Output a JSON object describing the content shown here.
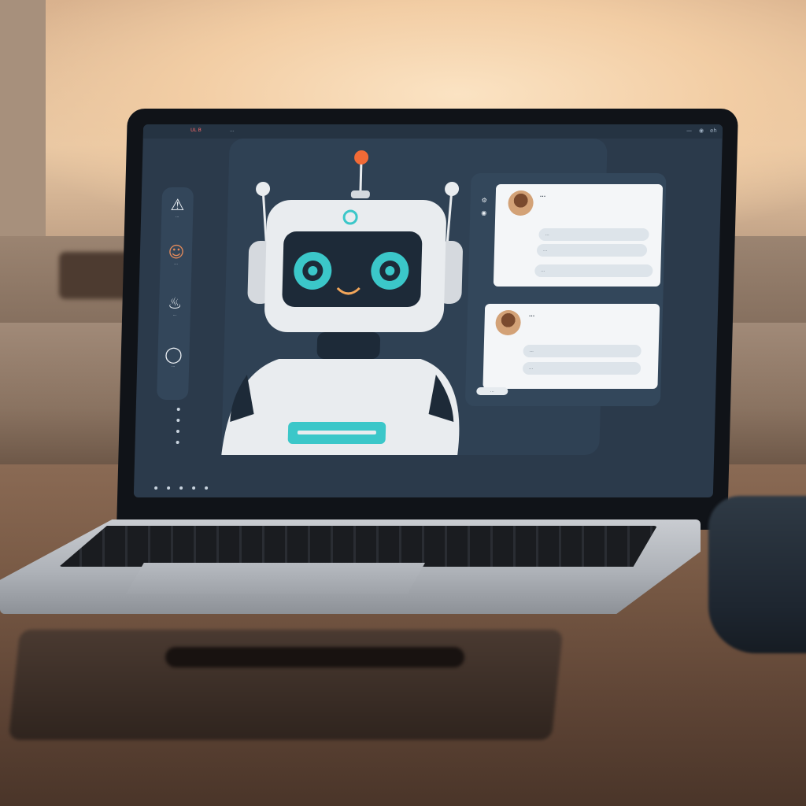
{
  "titlebar": {
    "left_text": "UL B",
    "right_text": "eh",
    "small_text": "..."
  },
  "sidebar": {
    "items": [
      {
        "icon": "warning-triangle-icon",
        "glyph": "⚠",
        "label": "..."
      },
      {
        "icon": "user-avatar-icon",
        "glyph": "☺",
        "label": "..."
      },
      {
        "icon": "data-icon",
        "glyph": "♨",
        "label": "..."
      },
      {
        "icon": "ring-icon",
        "glyph": "◯",
        "label": "..."
      }
    ]
  },
  "chat": {
    "messages": [
      {
        "text": "...",
        "replies": [
          "...",
          "...",
          "..."
        ]
      },
      {
        "text": "...",
        "replies": [
          "...",
          "..."
        ]
      }
    ],
    "send_label": "..."
  },
  "colors": {
    "screen_bg": "#2b3a4b",
    "card_bg": "#2f4154",
    "accent_teal": "#3bc7c9",
    "antenna_orange": "#f26a36",
    "robot_white": "#e9ecef"
  }
}
